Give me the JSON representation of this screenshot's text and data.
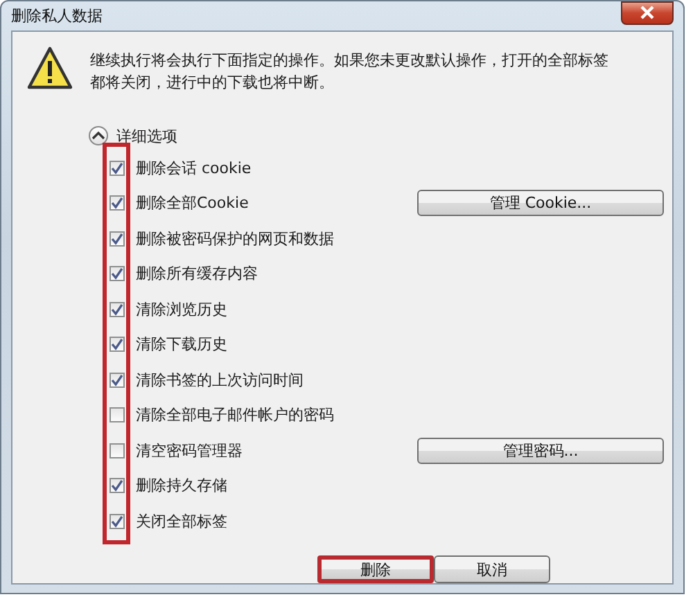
{
  "window": {
    "title": "删除私人数据"
  },
  "message": "继续执行将会执行下面指定的操作。如果您未更改默认操作，打开的全部标签都将关闭，进行中的下载也将中断。",
  "details": {
    "label": "详细选项",
    "expanded": true
  },
  "checkboxes_highlighted": true,
  "options": [
    {
      "label": "删除会话 cookie",
      "checked": true
    },
    {
      "label": "删除全部Cookie",
      "checked": true,
      "button": "管理 Cookie..."
    },
    {
      "label": "删除被密码保护的网页和数据",
      "checked": true
    },
    {
      "label": "删除所有缓存内容",
      "checked": true
    },
    {
      "label": "清除浏览历史",
      "checked": true
    },
    {
      "label": "清除下载历史",
      "checked": true
    },
    {
      "label": "清除书签的上次访问时间",
      "checked": true
    },
    {
      "label": "清除全部电子邮件帐户的密码",
      "checked": false
    },
    {
      "label": "清空密码管理器",
      "checked": false,
      "button": "管理密码..."
    },
    {
      "label": "删除持久存储",
      "checked": true
    },
    {
      "label": "关闭全部标签",
      "checked": true
    }
  ],
  "buttons": [
    {
      "label": "删除",
      "highlighted": true
    },
    {
      "label": "取消",
      "highlighted": false
    }
  ]
}
